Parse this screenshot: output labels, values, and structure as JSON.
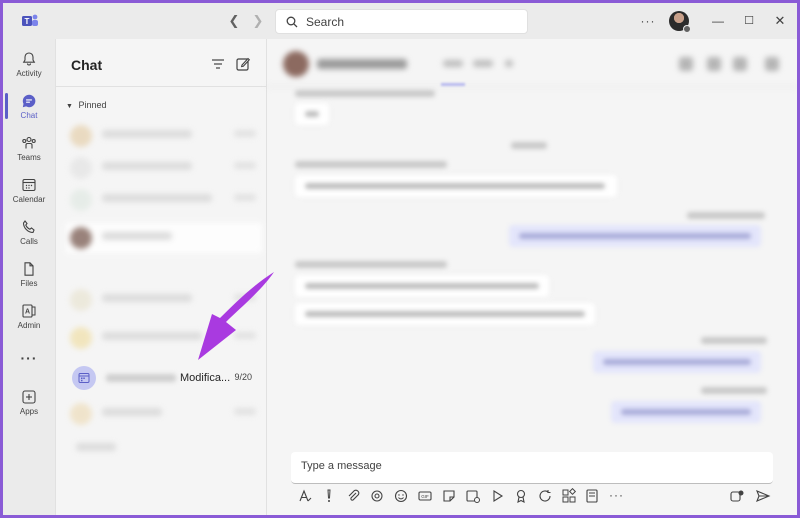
{
  "window": {
    "search_placeholder": "Search"
  },
  "rail": {
    "items": [
      {
        "label": "Activity",
        "icon": "bell-icon"
      },
      {
        "label": "Chat",
        "icon": "chat-icon"
      },
      {
        "label": "Teams",
        "icon": "teams-icon"
      },
      {
        "label": "Calendar",
        "icon": "calendar-icon"
      },
      {
        "label": "Calls",
        "icon": "phone-icon"
      },
      {
        "label": "Files",
        "icon": "file-icon"
      },
      {
        "label": "Admin",
        "icon": "admin-icon"
      },
      {
        "label": "",
        "icon": "more-icon"
      },
      {
        "label": "Apps",
        "icon": "add-app-icon"
      }
    ]
  },
  "chat_panel": {
    "title": "Chat",
    "pinned_label": "Pinned",
    "visible_item": {
      "preview": "Modifica...",
      "date": "9/20"
    }
  },
  "composer": {
    "placeholder": "Type a message"
  },
  "colors": {
    "accent": "#5b5fc7",
    "annotation_arrow": "#a93ae0",
    "frame": "#8a5bd6"
  }
}
